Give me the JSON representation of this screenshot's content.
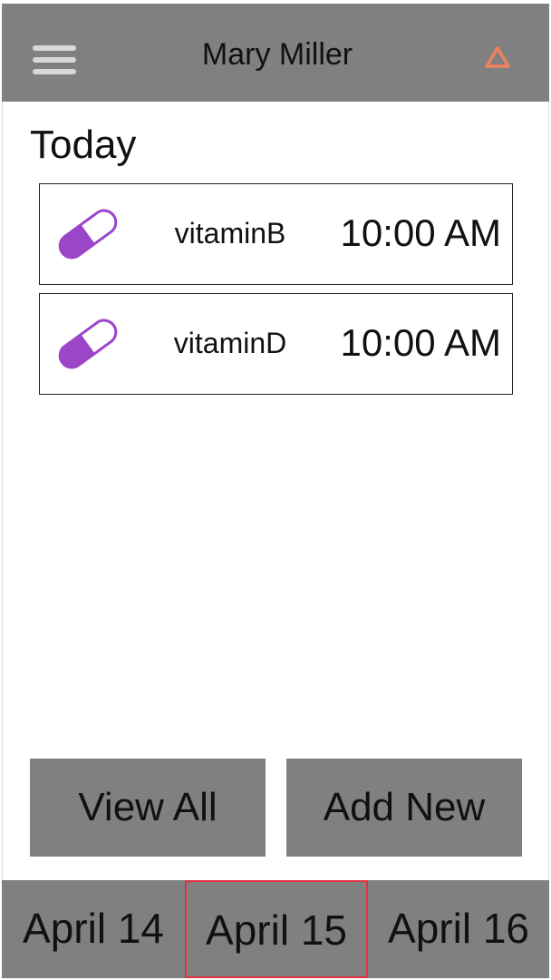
{
  "header": {
    "user_name": "Mary Miller",
    "menu_icon": "hamburger-menu-icon",
    "alert_icon": "triangle-alert-icon",
    "alert_color": "#f0825c"
  },
  "today": {
    "title": "Today",
    "medications": [
      {
        "name": "vitaminB",
        "time": "10:00 AM",
        "icon": "pill-capsule-icon"
      },
      {
        "name": "vitaminD",
        "time": "10:00 AM",
        "icon": "pill-capsule-icon"
      }
    ]
  },
  "actions": {
    "view_all": "View All",
    "add_new": "Add New"
  },
  "date_nav": {
    "dates": [
      "April 14",
      "April 15",
      "April 16"
    ],
    "selected_index": 1,
    "selected_color": "#e03040"
  },
  "colors": {
    "bar_gray": "#808080",
    "pill_purple": "#9b45c9"
  }
}
